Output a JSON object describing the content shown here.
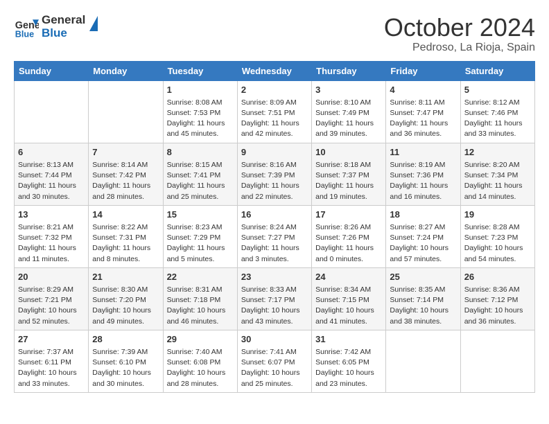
{
  "header": {
    "logo_line1": "General",
    "logo_line2": "Blue",
    "month": "October 2024",
    "location": "Pedroso, La Rioja, Spain"
  },
  "days_of_week": [
    "Sunday",
    "Monday",
    "Tuesday",
    "Wednesday",
    "Thursday",
    "Friday",
    "Saturday"
  ],
  "weeks": [
    [
      {
        "day": "",
        "info": ""
      },
      {
        "day": "",
        "info": ""
      },
      {
        "day": "1",
        "info": "Sunrise: 8:08 AM\nSunset: 7:53 PM\nDaylight: 11 hours and 45 minutes."
      },
      {
        "day": "2",
        "info": "Sunrise: 8:09 AM\nSunset: 7:51 PM\nDaylight: 11 hours and 42 minutes."
      },
      {
        "day": "3",
        "info": "Sunrise: 8:10 AM\nSunset: 7:49 PM\nDaylight: 11 hours and 39 minutes."
      },
      {
        "day": "4",
        "info": "Sunrise: 8:11 AM\nSunset: 7:47 PM\nDaylight: 11 hours and 36 minutes."
      },
      {
        "day": "5",
        "info": "Sunrise: 8:12 AM\nSunset: 7:46 PM\nDaylight: 11 hours and 33 minutes."
      }
    ],
    [
      {
        "day": "6",
        "info": "Sunrise: 8:13 AM\nSunset: 7:44 PM\nDaylight: 11 hours and 30 minutes."
      },
      {
        "day": "7",
        "info": "Sunrise: 8:14 AM\nSunset: 7:42 PM\nDaylight: 11 hours and 28 minutes."
      },
      {
        "day": "8",
        "info": "Sunrise: 8:15 AM\nSunset: 7:41 PM\nDaylight: 11 hours and 25 minutes."
      },
      {
        "day": "9",
        "info": "Sunrise: 8:16 AM\nSunset: 7:39 PM\nDaylight: 11 hours and 22 minutes."
      },
      {
        "day": "10",
        "info": "Sunrise: 8:18 AM\nSunset: 7:37 PM\nDaylight: 11 hours and 19 minutes."
      },
      {
        "day": "11",
        "info": "Sunrise: 8:19 AM\nSunset: 7:36 PM\nDaylight: 11 hours and 16 minutes."
      },
      {
        "day": "12",
        "info": "Sunrise: 8:20 AM\nSunset: 7:34 PM\nDaylight: 11 hours and 14 minutes."
      }
    ],
    [
      {
        "day": "13",
        "info": "Sunrise: 8:21 AM\nSunset: 7:32 PM\nDaylight: 11 hours and 11 minutes."
      },
      {
        "day": "14",
        "info": "Sunrise: 8:22 AM\nSunset: 7:31 PM\nDaylight: 11 hours and 8 minutes."
      },
      {
        "day": "15",
        "info": "Sunrise: 8:23 AM\nSunset: 7:29 PM\nDaylight: 11 hours and 5 minutes."
      },
      {
        "day": "16",
        "info": "Sunrise: 8:24 AM\nSunset: 7:27 PM\nDaylight: 11 hours and 3 minutes."
      },
      {
        "day": "17",
        "info": "Sunrise: 8:26 AM\nSunset: 7:26 PM\nDaylight: 11 hours and 0 minutes."
      },
      {
        "day": "18",
        "info": "Sunrise: 8:27 AM\nSunset: 7:24 PM\nDaylight: 10 hours and 57 minutes."
      },
      {
        "day": "19",
        "info": "Sunrise: 8:28 AM\nSunset: 7:23 PM\nDaylight: 10 hours and 54 minutes."
      }
    ],
    [
      {
        "day": "20",
        "info": "Sunrise: 8:29 AM\nSunset: 7:21 PM\nDaylight: 10 hours and 52 minutes."
      },
      {
        "day": "21",
        "info": "Sunrise: 8:30 AM\nSunset: 7:20 PM\nDaylight: 10 hours and 49 minutes."
      },
      {
        "day": "22",
        "info": "Sunrise: 8:31 AM\nSunset: 7:18 PM\nDaylight: 10 hours and 46 minutes."
      },
      {
        "day": "23",
        "info": "Sunrise: 8:33 AM\nSunset: 7:17 PM\nDaylight: 10 hours and 43 minutes."
      },
      {
        "day": "24",
        "info": "Sunrise: 8:34 AM\nSunset: 7:15 PM\nDaylight: 10 hours and 41 minutes."
      },
      {
        "day": "25",
        "info": "Sunrise: 8:35 AM\nSunset: 7:14 PM\nDaylight: 10 hours and 38 minutes."
      },
      {
        "day": "26",
        "info": "Sunrise: 8:36 AM\nSunset: 7:12 PM\nDaylight: 10 hours and 36 minutes."
      }
    ],
    [
      {
        "day": "27",
        "info": "Sunrise: 7:37 AM\nSunset: 6:11 PM\nDaylight: 10 hours and 33 minutes."
      },
      {
        "day": "28",
        "info": "Sunrise: 7:39 AM\nSunset: 6:10 PM\nDaylight: 10 hours and 30 minutes."
      },
      {
        "day": "29",
        "info": "Sunrise: 7:40 AM\nSunset: 6:08 PM\nDaylight: 10 hours and 28 minutes."
      },
      {
        "day": "30",
        "info": "Sunrise: 7:41 AM\nSunset: 6:07 PM\nDaylight: 10 hours and 25 minutes."
      },
      {
        "day": "31",
        "info": "Sunrise: 7:42 AM\nSunset: 6:05 PM\nDaylight: 10 hours and 23 minutes."
      },
      {
        "day": "",
        "info": ""
      },
      {
        "day": "",
        "info": ""
      }
    ]
  ]
}
